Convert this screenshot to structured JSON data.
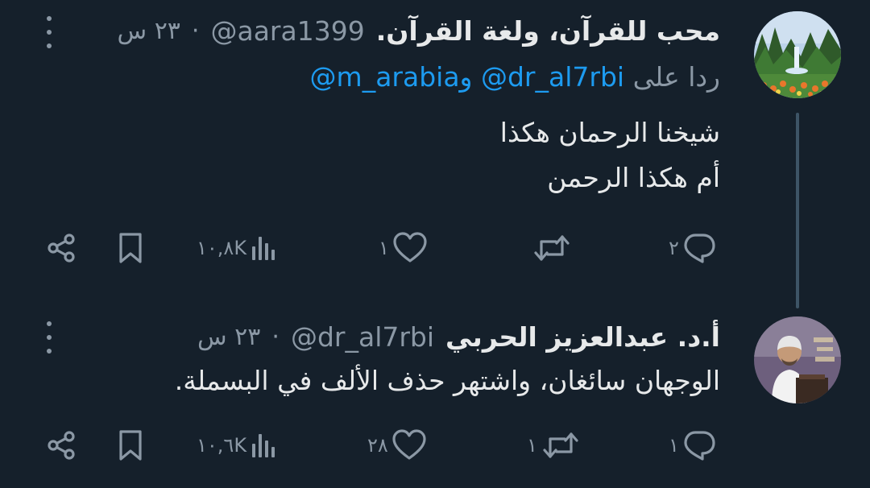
{
  "colors": {
    "background": "#15202b",
    "text": "#e7e9ea",
    "muted": "#8b98a5",
    "link": "#1d9bf0",
    "thread_line": "#3d5466"
  },
  "tweets": [
    {
      "display_name": "محب للقرآن، ولغة القرآن.",
      "handle": "@aara1399",
      "separator": "·",
      "time": "٢٣ س",
      "reply_label": "ردا على",
      "reply_mentions": [
        "@dr_al7rbi",
        "@m_arabia"
      ],
      "reply_joiner": "و",
      "body_lines": [
        "شيخنا الرحمان هكذا",
        "أم هكذا الرحمن"
      ],
      "actions": {
        "reply_count": "٢",
        "retweet_count": "",
        "like_count": "١",
        "views_count": "١٠,٨K"
      },
      "icons": {
        "reply": "reply-icon",
        "retweet": "retweet-icon",
        "like": "heart-icon",
        "views": "views-icon",
        "bookmark": "bookmark-icon",
        "share": "share-icon",
        "more": "more-icon"
      }
    },
    {
      "display_name": "أ.د. عبدالعزيز الحربي",
      "handle": "@dr_al7rbi",
      "separator": "·",
      "time": "٢٣ س",
      "body_lines": [
        "الوجهان سائغان، واشتهر حذف الألف في البسملة."
      ],
      "actions": {
        "reply_count": "١",
        "retweet_count": "١",
        "like_count": "٢٨",
        "views_count": "١٠,٦K"
      },
      "icons": {
        "reply": "reply-icon",
        "retweet": "retweet-icon",
        "like": "heart-icon",
        "views": "views-icon",
        "bookmark": "bookmark-icon",
        "share": "share-icon",
        "more": "more-icon"
      }
    }
  ]
}
